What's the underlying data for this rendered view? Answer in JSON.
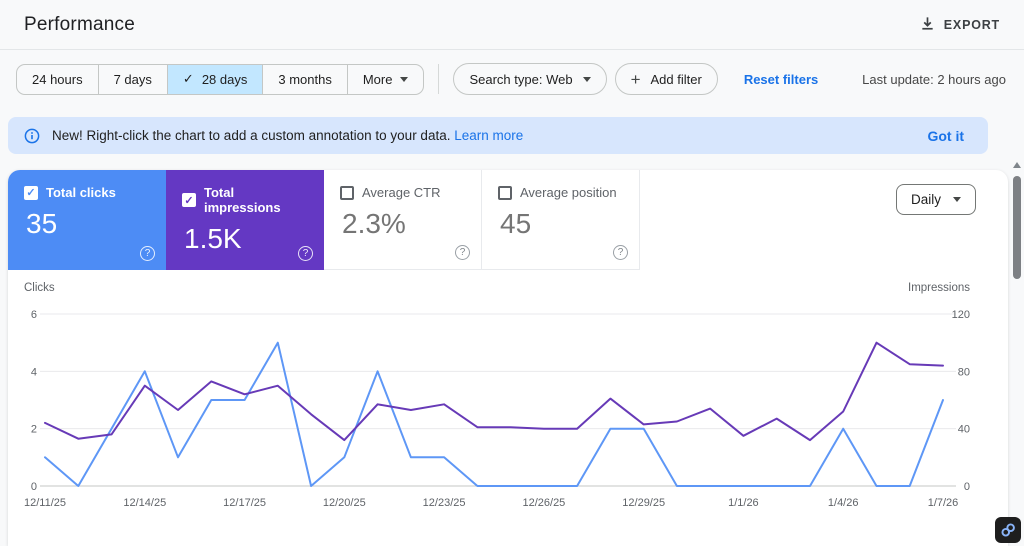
{
  "header": {
    "title": "Performance",
    "export_label": "EXPORT"
  },
  "filters": {
    "date_ranges": [
      {
        "label": "24 hours"
      },
      {
        "label": "7 days"
      },
      {
        "label": "28 days"
      },
      {
        "label": "3 months"
      },
      {
        "label": "More"
      }
    ],
    "selected_range": "28 days",
    "search_type_label": "Search type: Web",
    "add_filter_label": "Add filter",
    "reset_label": "Reset filters",
    "last_update": "Last update: 2 hours ago"
  },
  "banner": {
    "text": "New! Right-click the chart to add a custom annotation to your data.",
    "link_label": "Learn more",
    "dismiss_label": "Got it"
  },
  "metrics": [
    {
      "label": "Total clicks",
      "value": "35",
      "checked": true,
      "color": "#4d8cf5"
    },
    {
      "label": "Total impressions",
      "value": "1.5K",
      "checked": true,
      "color": "#6438c3"
    },
    {
      "label": "Average CTR",
      "value": "2.3%",
      "checked": false
    },
    {
      "label": "Average position",
      "value": "45",
      "checked": false
    }
  ],
  "granularity": "Daily",
  "chart_data": {
    "type": "line",
    "x": [
      "12/11/25",
      "12/12/25",
      "12/13/25",
      "12/14/25",
      "12/15/25",
      "12/16/25",
      "12/17/25",
      "12/18/25",
      "12/19/25",
      "12/20/25",
      "12/21/25",
      "12/22/25",
      "12/23/25",
      "12/24/25",
      "12/25/25",
      "12/26/25",
      "12/27/25",
      "12/28/25",
      "12/29/25",
      "12/30/25",
      "12/31/25",
      "1/1/26",
      "1/2/26",
      "1/3/26",
      "1/4/26",
      "1/5/26",
      "1/6/26",
      "1/7/26"
    ],
    "x_tick_every": 3,
    "series": [
      {
        "name": "Clicks",
        "axis": "left",
        "color": "#5e97f6",
        "values": [
          1,
          0,
          2,
          4,
          1,
          3,
          3,
          5,
          0,
          1,
          4,
          1,
          1,
          0,
          0,
          0,
          0,
          2,
          2,
          0,
          0,
          0,
          0,
          0,
          2,
          0,
          0,
          3
        ]
      },
      {
        "name": "Impressions",
        "axis": "right",
        "color": "#673ab7",
        "values": [
          44,
          33,
          36,
          70,
          53,
          73,
          64,
          70,
          50,
          32,
          57,
          53,
          57,
          41,
          41,
          40,
          40,
          61,
          43,
          45,
          54,
          35,
          47,
          32,
          52,
          100,
          85,
          84
        ]
      }
    ],
    "left_axis": {
      "label": "Clicks",
      "ticks": [
        6,
        4,
        2,
        0
      ],
      "max": 6
    },
    "right_axis": {
      "label": "Impressions",
      "ticks": [
        120,
        80,
        40,
        0
      ],
      "max": 120
    },
    "grid": true,
    "legend_position": "none"
  }
}
